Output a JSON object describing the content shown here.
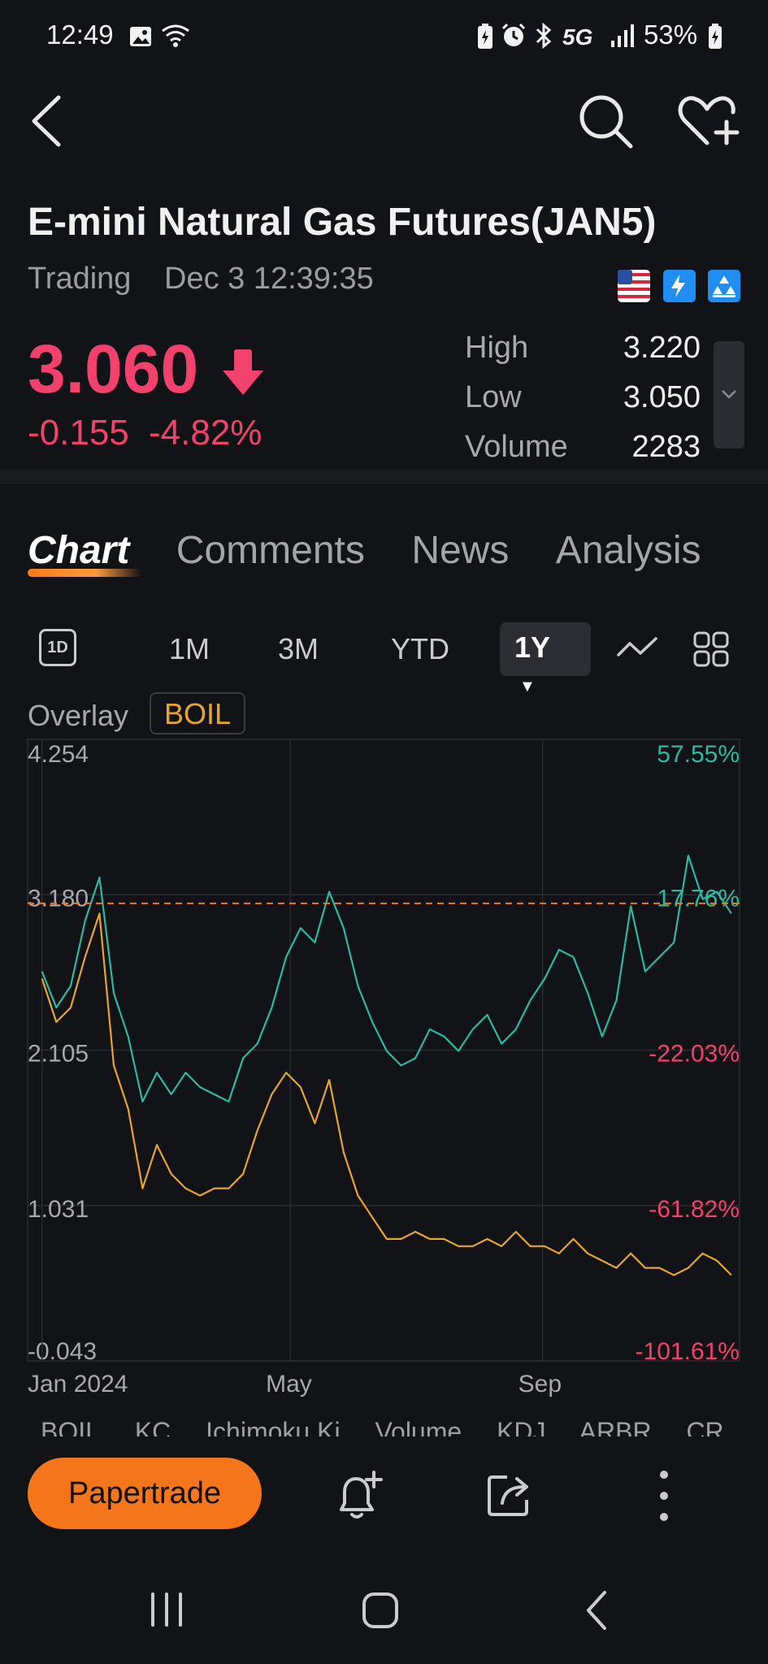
{
  "status_bar": {
    "time": "12:49",
    "network": "5G",
    "battery": "53%"
  },
  "header": {
    "title": "E-mini Natural Gas Futures(JAN5)",
    "status": "Trading",
    "timestamp": "Dec 3 12:39:35"
  },
  "quote": {
    "price": "3.060",
    "change": "-0.155",
    "change_pct": "-4.82%",
    "stats": [
      {
        "label": "High",
        "value": "3.220"
      },
      {
        "label": "Low",
        "value": "3.050"
      },
      {
        "label": "Volume",
        "value": "2283"
      }
    ]
  },
  "tabs": [
    {
      "label": "Chart",
      "active": true
    },
    {
      "label": "Comments",
      "active": false
    },
    {
      "label": "News",
      "active": false
    },
    {
      "label": "Analysis",
      "active": false
    }
  ],
  "periods": {
    "icon_label": "1D",
    "items": [
      "1M",
      "3M",
      "YTD"
    ],
    "selected": "1Y"
  },
  "overlay": {
    "label": "Overlay",
    "symbol": "BOIL"
  },
  "colors": {
    "up": "#2bb9a0",
    "down": "#f2416d",
    "overlay": "#e6a62e",
    "accent": "#f5761a"
  },
  "chart_data": {
    "type": "line",
    "x_labels": [
      "Jan 2024",
      "May",
      "Sep"
    ],
    "y_left_ticks": [
      "4.254",
      "3.180",
      "2.105",
      "1.031",
      "-0.043"
    ],
    "y_right_ticks": [
      "57.55%",
      "17.76%",
      "-22.03%",
      "-61.82%",
      "-101.61%"
    ],
    "ylim": [
      -0.043,
      4.254
    ],
    "reference_line": 3.12,
    "series": [
      {
        "name": "",
        "color": "#2bb9a0",
        "x": [
          "2024-01-01",
          "2024-01-08",
          "2024-01-15",
          "2024-01-22",
          "2024-01-29",
          "2024-02-05",
          "2024-02-12",
          "2024-02-19",
          "2024-02-26",
          "2024-03-04",
          "2024-03-11",
          "2024-03-18",
          "2024-03-25",
          "2024-04-01",
          "2024-04-08",
          "2024-04-15",
          "2024-04-22",
          "2024-04-29",
          "2024-05-06",
          "2024-05-13",
          "2024-05-20",
          "2024-05-27",
          "2024-06-03",
          "2024-06-10",
          "2024-06-17",
          "2024-06-24",
          "2024-07-01",
          "2024-07-08",
          "2024-07-15",
          "2024-07-22",
          "2024-07-29",
          "2024-08-05",
          "2024-08-12",
          "2024-08-19",
          "2024-08-26",
          "2024-09-02",
          "2024-09-09",
          "2024-09-16",
          "2024-09-23",
          "2024-09-30",
          "2024-10-07",
          "2024-10-14",
          "2024-10-21",
          "2024-10-28",
          "2024-11-04",
          "2024-11-11",
          "2024-11-18",
          "2024-11-25",
          "2024-12-02"
        ],
        "values": [
          2.65,
          2.4,
          2.55,
          3.0,
          3.3,
          2.5,
          2.2,
          1.75,
          1.95,
          1.8,
          1.95,
          1.85,
          1.8,
          1.75,
          2.05,
          2.15,
          2.4,
          2.75,
          2.95,
          2.85,
          3.2,
          2.95,
          2.55,
          2.3,
          2.1,
          2.0,
          2.05,
          2.25,
          2.2,
          2.1,
          2.25,
          2.35,
          2.15,
          2.25,
          2.45,
          2.6,
          2.8,
          2.75,
          2.5,
          2.2,
          2.45,
          3.1,
          2.65,
          2.75,
          2.85,
          3.45,
          3.15,
          3.2,
          3.05
        ]
      },
      {
        "name": "BOIL",
        "color": "#e6a62e",
        "x": [
          "2024-01-01",
          "2024-01-08",
          "2024-01-15",
          "2024-01-22",
          "2024-01-29",
          "2024-02-05",
          "2024-02-12",
          "2024-02-19",
          "2024-02-26",
          "2024-03-04",
          "2024-03-11",
          "2024-03-18",
          "2024-03-25",
          "2024-04-01",
          "2024-04-08",
          "2024-04-15",
          "2024-04-22",
          "2024-04-29",
          "2024-05-06",
          "2024-05-13",
          "2024-05-20",
          "2024-05-27",
          "2024-06-03",
          "2024-06-10",
          "2024-06-17",
          "2024-06-24",
          "2024-07-01",
          "2024-07-08",
          "2024-07-15",
          "2024-07-22",
          "2024-07-29",
          "2024-08-05",
          "2024-08-12",
          "2024-08-19",
          "2024-08-26",
          "2024-09-02",
          "2024-09-09",
          "2024-09-16",
          "2024-09-23",
          "2024-09-30",
          "2024-10-07",
          "2024-10-14",
          "2024-10-21",
          "2024-10-28",
          "2024-11-04",
          "2024-11-11",
          "2024-11-18",
          "2024-11-25",
          "2024-12-02"
        ],
        "values": [
          2.6,
          2.3,
          2.4,
          2.75,
          3.05,
          2.0,
          1.7,
          1.15,
          1.45,
          1.25,
          1.15,
          1.1,
          1.15,
          1.15,
          1.25,
          1.55,
          1.8,
          1.95,
          1.85,
          1.6,
          1.9,
          1.4,
          1.1,
          0.95,
          0.8,
          0.8,
          0.85,
          0.8,
          0.8,
          0.75,
          0.75,
          0.8,
          0.75,
          0.85,
          0.75,
          0.75,
          0.7,
          0.8,
          0.7,
          0.65,
          0.6,
          0.7,
          0.6,
          0.6,
          0.55,
          0.6,
          0.7,
          0.65,
          0.55
        ]
      }
    ]
  },
  "indicators": [
    "BOIL",
    "KC",
    "Ichimoku Ki",
    "Volume",
    "KDJ",
    "ARBR",
    "CR"
  ],
  "actions": {
    "papertrade": "Papertrade"
  }
}
